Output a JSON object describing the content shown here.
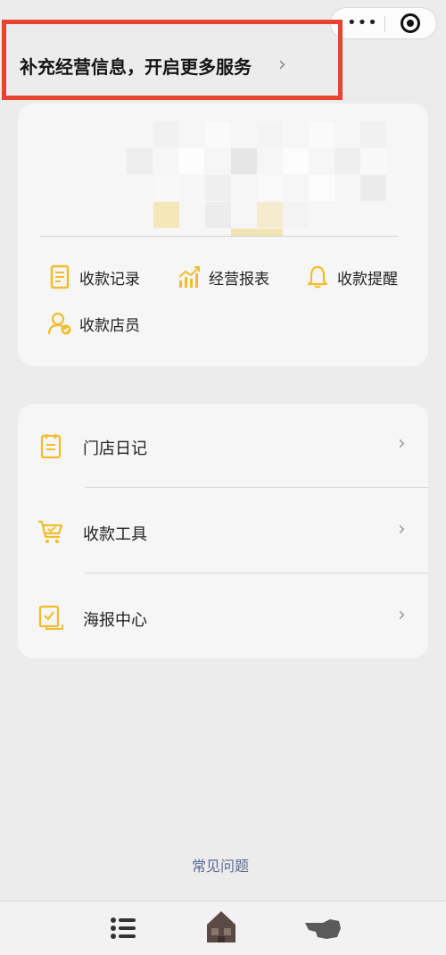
{
  "banner": {
    "text": "补充经营信息，开启更多服务"
  },
  "capsule": {
    "more_icon": "more-dots-icon",
    "close_icon": "target-icon"
  },
  "summary": {
    "quick_actions": [
      {
        "label": "收款记录",
        "icon": "document-icon"
      },
      {
        "label": "经营报表",
        "icon": "chart-icon"
      },
      {
        "label": "收款提醒",
        "icon": "bell-icon"
      },
      {
        "label": "收款店员",
        "icon": "staff-icon"
      }
    ]
  },
  "menu": {
    "items": [
      {
        "label": "门店日记",
        "icon": "notebook-icon"
      },
      {
        "label": "收款工具",
        "icon": "cart-icon"
      },
      {
        "label": "海报中心",
        "icon": "poster-icon"
      }
    ]
  },
  "faq": {
    "label": "常见问题"
  },
  "colors": {
    "accent": "#f2bd2b",
    "highlight": "#e8432f",
    "link": "#5a6a93"
  }
}
